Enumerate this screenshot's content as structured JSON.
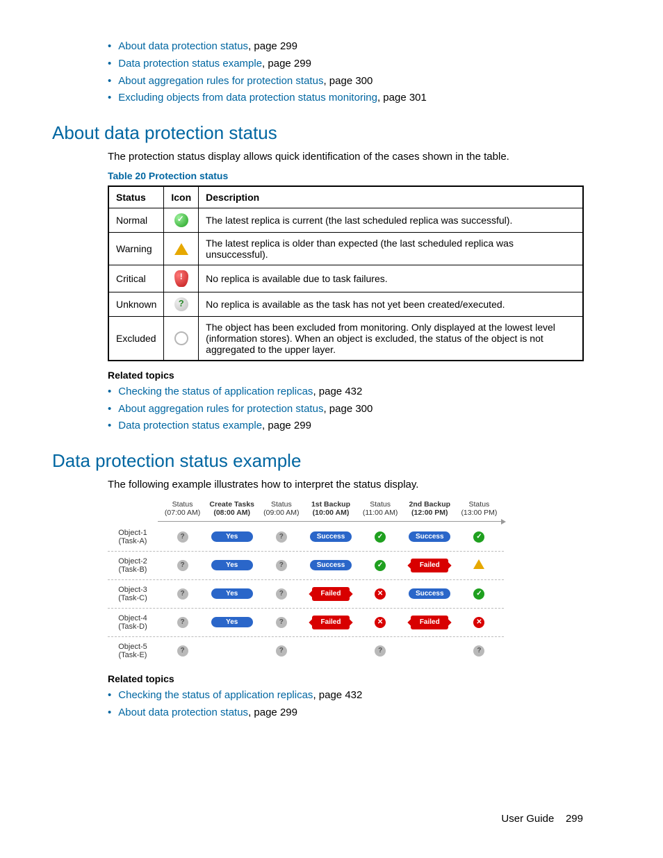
{
  "toc_top": [
    {
      "text": "About data protection status",
      "page": "299"
    },
    {
      "text": "Data protection status example",
      "page": "299"
    },
    {
      "text": "About aggregation rules for protection status",
      "page": "300"
    },
    {
      "text": "Excluding objects from data protection status monitoring",
      "page": "301"
    }
  ],
  "section1": {
    "heading": "About data protection status",
    "intro": "The protection status display allows quick identification of the cases shown in the table.",
    "table_caption": "Table 20 Protection status",
    "table_headers": [
      "Status",
      "Icon",
      "Description"
    ],
    "rows": [
      {
        "status": "Normal",
        "icon": "normal",
        "desc": "The latest replica is current (the last scheduled replica was successful)."
      },
      {
        "status": "Warning",
        "icon": "warning",
        "desc": "The latest replica is older than expected (the last scheduled replica was unsuccessful)."
      },
      {
        "status": "Critical",
        "icon": "critical",
        "desc": "No replica is available due to task failures."
      },
      {
        "status": "Unknown",
        "icon": "unknown",
        "desc": "No replica is available as the task has not yet been created/executed."
      },
      {
        "status": "Excluded",
        "icon": "excluded",
        "desc": "The object has been excluded from monitoring. Only displayed at the lowest level (information stores). When an object is excluded, the status of the object is not aggregated to the upper layer."
      }
    ],
    "related_heading": "Related topics",
    "related": [
      {
        "text": "Checking the status of application replicas",
        "page": "432"
      },
      {
        "text": "About aggregation rules for protection status",
        "page": "300"
      },
      {
        "text": "Data protection status example",
        "page": "299"
      }
    ]
  },
  "section2": {
    "heading": "Data protection status example",
    "intro": "The following example illustrates how to interpret the status display.",
    "columns": [
      {
        "title": "",
        "sub": ""
      },
      {
        "title": "Status",
        "sub": "(07:00 AM)"
      },
      {
        "title": "Create Tasks",
        "sub": "(08:00 AM)",
        "bold": true
      },
      {
        "title": "Status",
        "sub": "(09:00 AM)"
      },
      {
        "title": "1st Backup",
        "sub": "(10:00 AM)",
        "bold": true
      },
      {
        "title": "Status",
        "sub": "(11:00 AM)"
      },
      {
        "title": "2nd Backup",
        "sub": "(12:00 PM)",
        "bold": true
      },
      {
        "title": "Status",
        "sub": "(13:00 PM)"
      }
    ],
    "objects": [
      {
        "name": "Object-1",
        "task": "(Task-A)",
        "cells": [
          "q",
          "yes",
          "q",
          "success",
          "ok",
          "success",
          "ok"
        ]
      },
      {
        "name": "Object-2",
        "task": "(Task-B)",
        "cells": [
          "q",
          "yes",
          "q",
          "success",
          "ok",
          "failed",
          "w"
        ]
      },
      {
        "name": "Object-3",
        "task": "(Task-C)",
        "cells": [
          "q",
          "yes",
          "q",
          "failed",
          "err",
          "success",
          "ok"
        ]
      },
      {
        "name": "Object-4",
        "task": "(Task-D)",
        "cells": [
          "q",
          "yes",
          "q",
          "failed",
          "err",
          "failed",
          "err"
        ]
      },
      {
        "name": "Object-5",
        "task": "(Task-E)",
        "cells": [
          "q",
          "",
          "q",
          "",
          "q",
          "",
          "q"
        ]
      }
    ],
    "labels": {
      "yes": "Yes",
      "success": "Success",
      "failed": "Failed"
    },
    "related_heading": "Related topics",
    "related": [
      {
        "text": "Checking the status of application replicas",
        "page": "432"
      },
      {
        "text": "About data protection status",
        "page": "299"
      }
    ]
  },
  "footer": {
    "label": "User Guide",
    "page": "299"
  },
  "page_word": ", page "
}
